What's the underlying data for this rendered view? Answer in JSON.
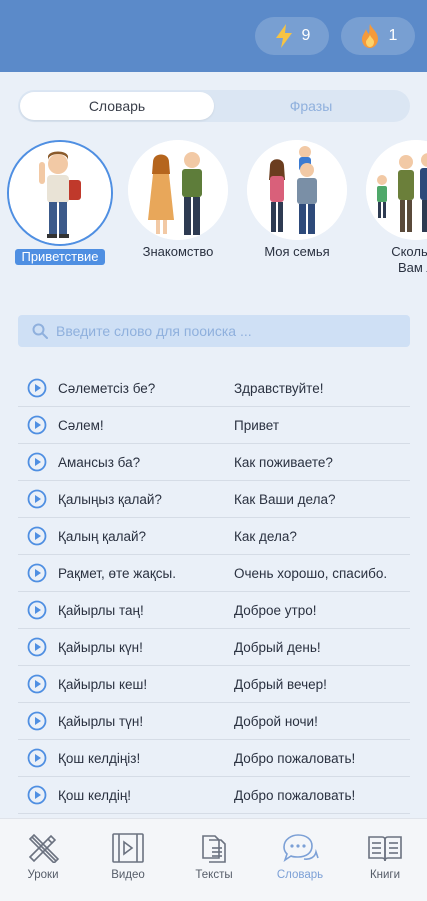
{
  "header": {
    "energy_count": "9",
    "streak_count": "1",
    "bg_color": "#5b8ac9"
  },
  "segment": {
    "tabs": [
      {
        "label": "Словарь",
        "active": true
      },
      {
        "label": "Фразы",
        "active": false
      }
    ]
  },
  "categories": [
    {
      "label": "Приветствие",
      "active": true
    },
    {
      "label": "Знакомство",
      "active": false
    },
    {
      "label": "Моя семья",
      "active": false
    },
    {
      "label": "Сколько\nВам л",
      "active": false
    }
  ],
  "search": {
    "placeholder": "Введите слово для пооиска ..."
  },
  "phrases": [
    {
      "kz": "Сәлеметсіз бе?",
      "ru": "Здравствуйте!"
    },
    {
      "kz": "Сәлем!",
      "ru": "Привет"
    },
    {
      "kz": "Амансыз ба?",
      "ru": "Как поживаете?"
    },
    {
      "kz": "Қалыңыз қалай?",
      "ru": "Как Ваши дела?"
    },
    {
      "kz": "Қалың қалай?",
      "ru": "Как дела?"
    },
    {
      "kz": "Рақмет, өте жақсы.",
      "ru": "Очень хорошо, спасибо."
    },
    {
      "kz": "Қайырлы таң!",
      "ru": "Доброе утро!"
    },
    {
      "kz": "Қайырлы күн!",
      "ru": "Добрый день!"
    },
    {
      "kz": "Қайырлы кеш!",
      "ru": "Добрый вечер!"
    },
    {
      "kz": "Қайырлы түн!",
      "ru": "Доброй ночи!"
    },
    {
      "kz": "Қош келдіңіз!",
      "ru": "Добро пожаловать!"
    },
    {
      "kz": "Қош келдің!",
      "ru": "Добро пожаловать!"
    }
  ],
  "bottom_nav": [
    {
      "label": "Уроки",
      "icon": "pencil-ruler-icon",
      "active": false
    },
    {
      "label": "Видео",
      "icon": "video-icon",
      "active": false
    },
    {
      "label": "Тексты",
      "icon": "documents-icon",
      "active": false
    },
    {
      "label": "Словарь",
      "icon": "chat-bubbles-icon",
      "active": true
    },
    {
      "label": "Книги",
      "icon": "book-icon",
      "active": false
    }
  ],
  "accent_color": "#4f8fe2"
}
